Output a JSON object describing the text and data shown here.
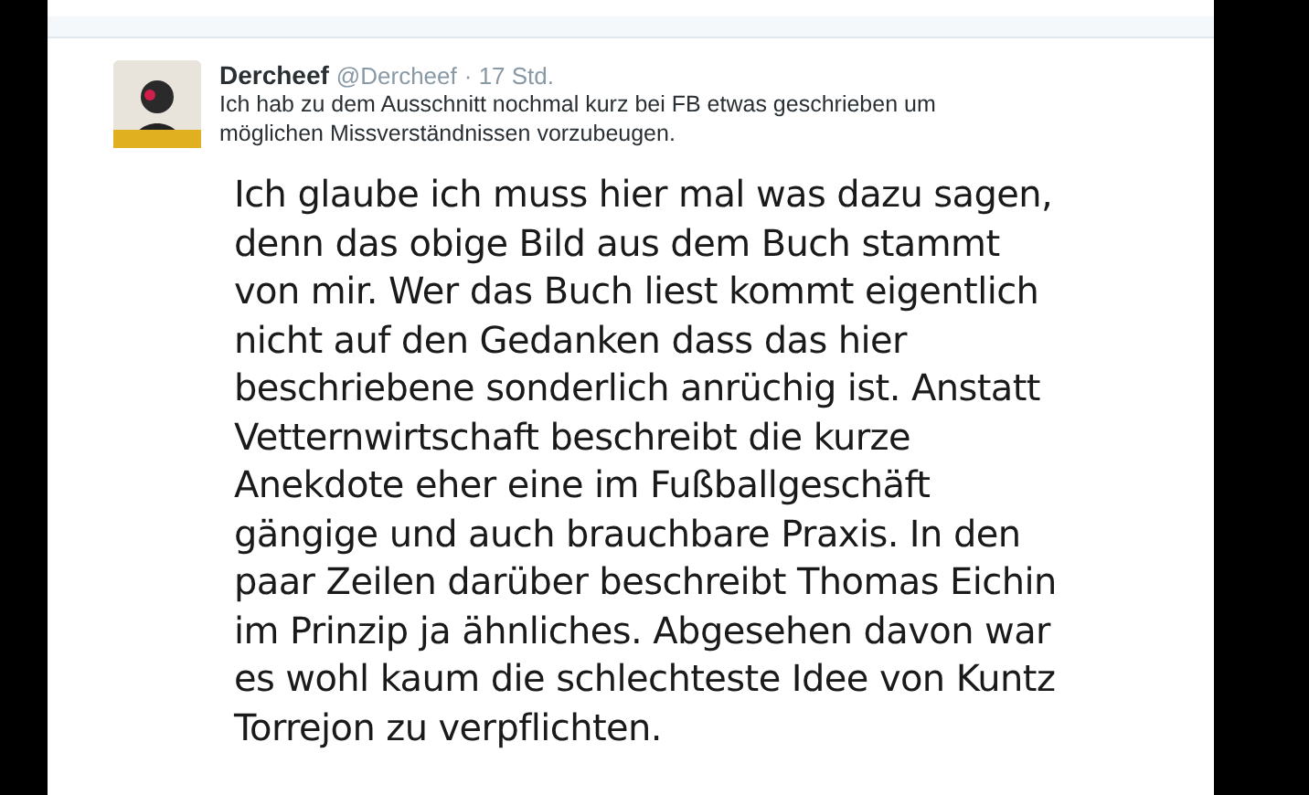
{
  "tweet": {
    "author": "Dercheef",
    "handle": "@Dercheef",
    "time": "· 17 Std.",
    "text": "Ich hab zu dem Ausschnitt nochmal kurz bei FB etwas geschrieben um möglichen Missverständnissen vorzubeugen.",
    "image_lines": [
      "Ich glaube ich muss hier mal was dazu sagen,",
      "denn das obige Bild aus dem Buch stammt",
      "von mir. Wer das Buch liest kommt eigentlich",
      "nicht auf den Gedanken dass das hier",
      "beschriebene sonderlich anrüchig ist. Anstatt",
      "Vetternwirtschaft beschreibt die kurze",
      "Anekdote eher eine im Fußballgeschäft",
      "gängige und auch brauchbare Praxis. In den",
      "paar Zeilen darüber beschreibt Thomas Eichin",
      "im Prinzip ja ähnliches. Abgesehen davon war",
      "es wohl kaum die schlechteste Idee von Kuntz",
      "Torrejon zu verpflichten."
    ]
  }
}
